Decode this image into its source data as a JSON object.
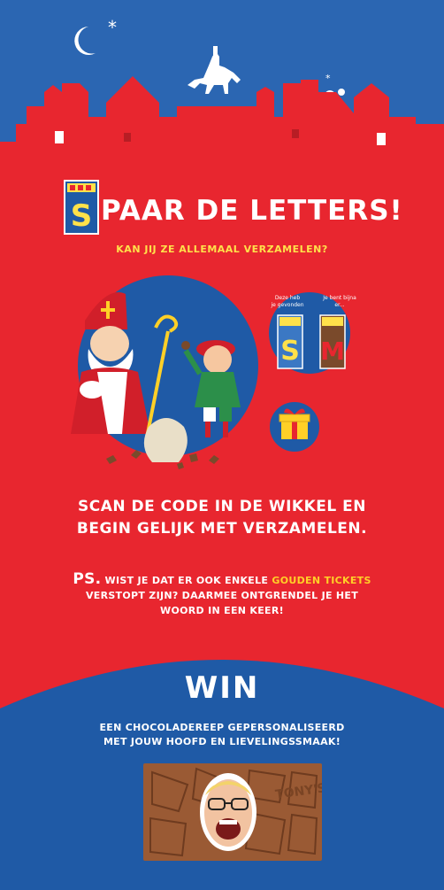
{
  "headline": {
    "letter": "S",
    "rest": "PAAR DE LETTERS!"
  },
  "subhead": "KAN JIJ ZE ALLEMAAL VERZAMELEN?",
  "collection": {
    "found_label_line1": "Deze heb",
    "found_label_line2": "je gevonden",
    "hint_label_line1": "Je bent bijna",
    "hint_label_line2": "er..."
  },
  "letters": [
    "S",
    "M"
  ],
  "scan_text_line1": "SCAN DE CODE IN DE WIKKEL EN",
  "scan_text_line2": "BEGIN GELIJK MET VERZAMELEN.",
  "ps": {
    "label": "PS.",
    "text_before": "WIST JE DAT ER OOK ENKELE",
    "highlight": "GOUDEN TICKETS",
    "line2": "VERSTOPT ZIJN? DAARMEE ONTGRENDEL JE HET",
    "line3": "WOORD IN EEN KEER!"
  },
  "win": {
    "title": "WIN",
    "line1": "EEN CHOCOLADEREEP GEPERSONALISEERD",
    "line2": "MET JOUW HOOFD EN LIEVELINGSSMAAK!"
  },
  "colors": {
    "red": "#e8262f",
    "blue": "#1f5aa6",
    "sky": "#2b66b2",
    "gold": "#ffd027",
    "yellow": "#ffe14a"
  }
}
